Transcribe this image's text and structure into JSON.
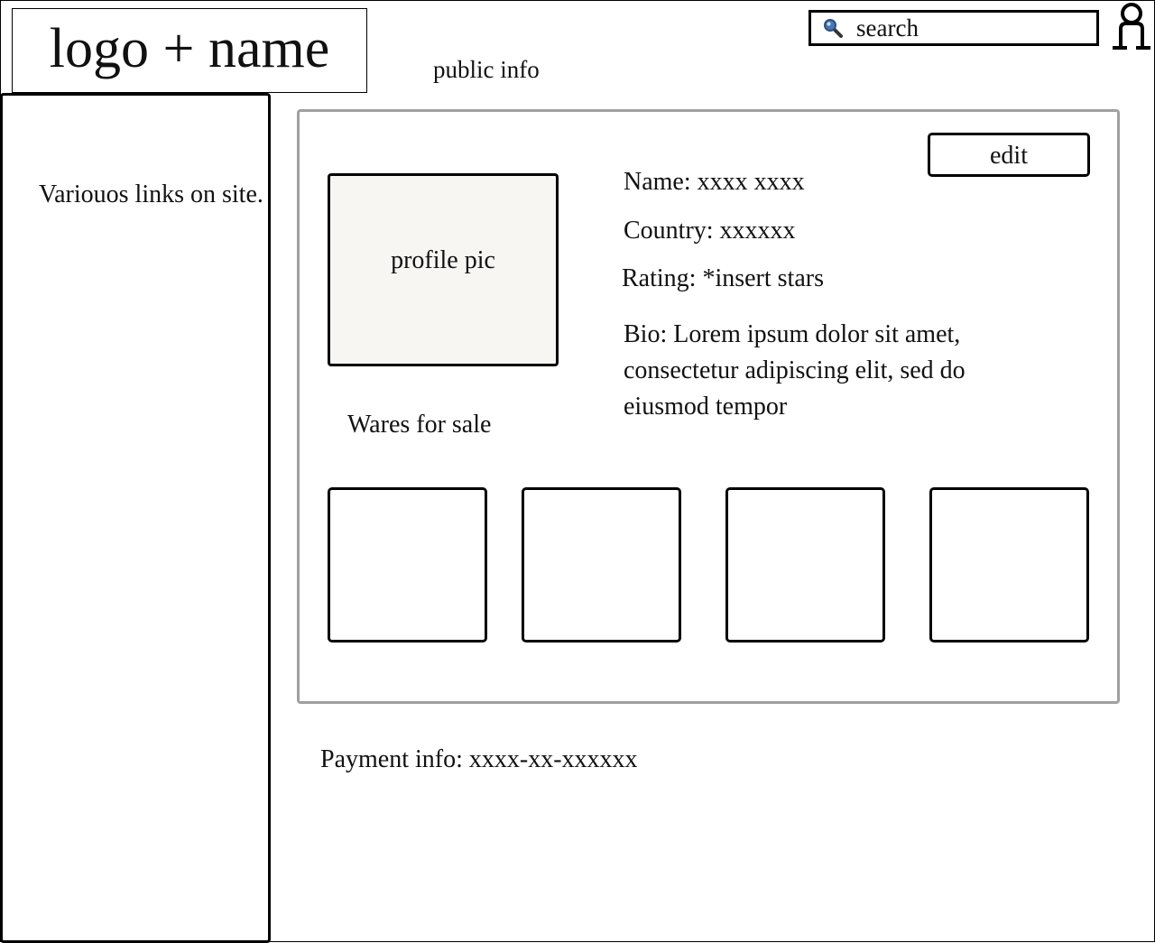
{
  "header": {
    "logo_text": "logo + name",
    "page_label": "public info",
    "search_text": "search"
  },
  "icons": {
    "search": "search-icon",
    "user": "user-icon"
  },
  "sidebar": {
    "text": "Variouos links on site."
  },
  "profile": {
    "edit_label": "edit",
    "pic_label": "profile pic",
    "name_line": "Name: xxxx xxxx",
    "country_line": "Country: xxxxxx",
    "rating_line": "Rating: *insert stars",
    "bio_line": "Bio: Lorem ipsum dolor sit amet, consectetur adipiscing elit, sed do eiusmod tempor"
  },
  "wares": {
    "label": "Wares for sale",
    "items": [
      "",
      "",
      "",
      ""
    ]
  },
  "payment": {
    "line": "Payment info: xxxx-xx-xxxxxx"
  },
  "colors": {
    "panel_border": "#a0a0a0",
    "profile_pic_fill": "#f7f6f3",
    "search_icon": "#4a78b5"
  }
}
